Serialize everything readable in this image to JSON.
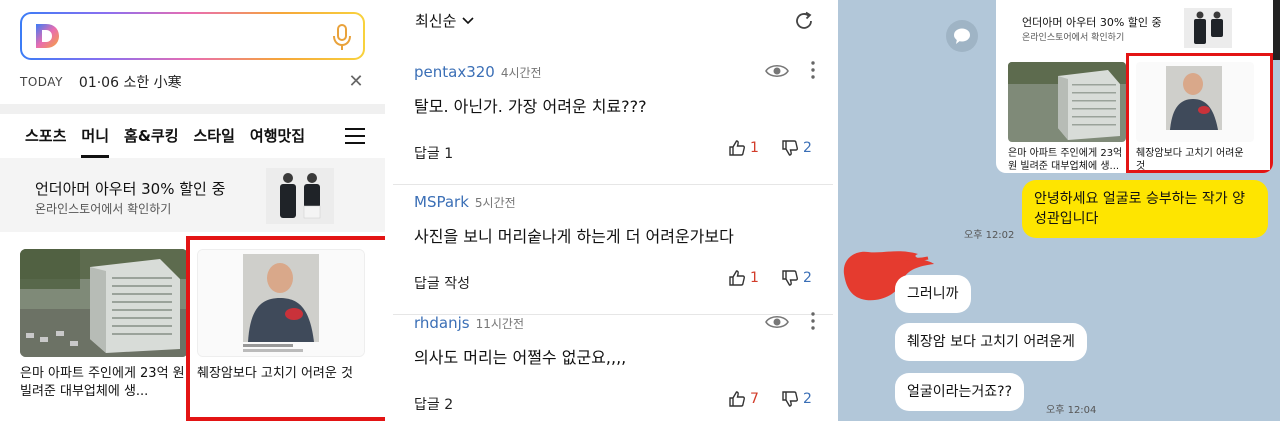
{
  "daum": {
    "today_label": "TODAY",
    "today_text": "01·06 소한 小寒",
    "close_glyph": "✕",
    "tabs": [
      "스포츠",
      "머니",
      "홈&쿠킹",
      "스타일",
      "여행맛집"
    ],
    "active_tab": "머니",
    "promo_title": "언더아머 아우터 30% 할인 중",
    "promo_sub": "온라인스토어에서 확인하기",
    "news": [
      {
        "title": "은마 아파트 주인에게 23억 원 빌려준 대부업체에 생..."
      },
      {
        "title": "췌장암보다 고치기 어려운 것"
      }
    ],
    "highlight_color": "#e31414"
  },
  "comments": {
    "sort_label": "최신순",
    "items": [
      {
        "user": "pentax320",
        "time": "4시간전",
        "text": "탈모. 아닌가. 가장 어려운 치료???",
        "reply": "답글 1",
        "up": "1",
        "down": "2"
      },
      {
        "user": "MSPark",
        "time": "5시간전",
        "text": "사진을 보니 머리숱나게 하는게 더 어려운가보다",
        "reply": "답글 작성",
        "up": "1",
        "down": "2"
      },
      {
        "user": "rhdanjs",
        "time": "11시간전",
        "text": "의사도 머리는 어쩔수 없군요,,,,",
        "reply": "답글 2",
        "up": "7",
        "down": "2"
      }
    ],
    "user_color": "#3b6fb6",
    "up_color": "#d23c2a"
  },
  "chat": {
    "card_promo_title": "언더아머 아우터 30% 할인 중",
    "card_promo_sub": "온라인스토어에서 확인하기",
    "card_news": [
      {
        "title": "은마 아파트 주인에게 23억 원 빌려준 대부업체에 생..."
      },
      {
        "title": "췌장암보다 고치기 어려운 것"
      }
    ],
    "my_message": "안녕하세요 얼굴로 승부하는 작가 양성관입니다",
    "my_time": "오후 12:02",
    "replies": [
      "그러니까",
      "췌장암 보다 고치기 어려운게",
      "얼굴이라는거죠??"
    ],
    "reply_time": "오후 12:04",
    "background": "#b2c7d9",
    "my_bubble_color": "#fee500"
  }
}
